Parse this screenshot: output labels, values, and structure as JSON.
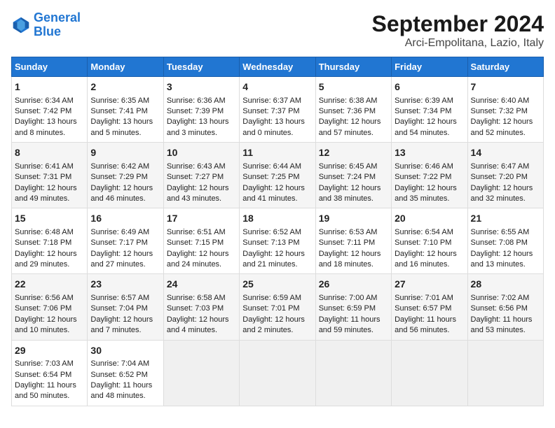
{
  "header": {
    "logo_line1": "General",
    "logo_line2": "Blue",
    "title": "September 2024",
    "subtitle": "Arci-Empolitana, Lazio, Italy"
  },
  "weekdays": [
    "Sunday",
    "Monday",
    "Tuesday",
    "Wednesday",
    "Thursday",
    "Friday",
    "Saturday"
  ],
  "weeks": [
    [
      {
        "day": "1",
        "sunrise": "6:34 AM",
        "sunset": "7:42 PM",
        "daylight": "13 hours and 8 minutes."
      },
      {
        "day": "2",
        "sunrise": "6:35 AM",
        "sunset": "7:41 PM",
        "daylight": "13 hours and 5 minutes."
      },
      {
        "day": "3",
        "sunrise": "6:36 AM",
        "sunset": "7:39 PM",
        "daylight": "13 hours and 3 minutes."
      },
      {
        "day": "4",
        "sunrise": "6:37 AM",
        "sunset": "7:37 PM",
        "daylight": "13 hours and 0 minutes."
      },
      {
        "day": "5",
        "sunrise": "6:38 AM",
        "sunset": "7:36 PM",
        "daylight": "12 hours and 57 minutes."
      },
      {
        "day": "6",
        "sunrise": "6:39 AM",
        "sunset": "7:34 PM",
        "daylight": "12 hours and 54 minutes."
      },
      {
        "day": "7",
        "sunrise": "6:40 AM",
        "sunset": "7:32 PM",
        "daylight": "12 hours and 52 minutes."
      }
    ],
    [
      {
        "day": "8",
        "sunrise": "6:41 AM",
        "sunset": "7:31 PM",
        "daylight": "12 hours and 49 minutes."
      },
      {
        "day": "9",
        "sunrise": "6:42 AM",
        "sunset": "7:29 PM",
        "daylight": "12 hours and 46 minutes."
      },
      {
        "day": "10",
        "sunrise": "6:43 AM",
        "sunset": "7:27 PM",
        "daylight": "12 hours and 43 minutes."
      },
      {
        "day": "11",
        "sunrise": "6:44 AM",
        "sunset": "7:25 PM",
        "daylight": "12 hours and 41 minutes."
      },
      {
        "day": "12",
        "sunrise": "6:45 AM",
        "sunset": "7:24 PM",
        "daylight": "12 hours and 38 minutes."
      },
      {
        "day": "13",
        "sunrise": "6:46 AM",
        "sunset": "7:22 PM",
        "daylight": "12 hours and 35 minutes."
      },
      {
        "day": "14",
        "sunrise": "6:47 AM",
        "sunset": "7:20 PM",
        "daylight": "12 hours and 32 minutes."
      }
    ],
    [
      {
        "day": "15",
        "sunrise": "6:48 AM",
        "sunset": "7:18 PM",
        "daylight": "12 hours and 29 minutes."
      },
      {
        "day": "16",
        "sunrise": "6:49 AM",
        "sunset": "7:17 PM",
        "daylight": "12 hours and 27 minutes."
      },
      {
        "day": "17",
        "sunrise": "6:51 AM",
        "sunset": "7:15 PM",
        "daylight": "12 hours and 24 minutes."
      },
      {
        "day": "18",
        "sunrise": "6:52 AM",
        "sunset": "7:13 PM",
        "daylight": "12 hours and 21 minutes."
      },
      {
        "day": "19",
        "sunrise": "6:53 AM",
        "sunset": "7:11 PM",
        "daylight": "12 hours and 18 minutes."
      },
      {
        "day": "20",
        "sunrise": "6:54 AM",
        "sunset": "7:10 PM",
        "daylight": "12 hours and 16 minutes."
      },
      {
        "day": "21",
        "sunrise": "6:55 AM",
        "sunset": "7:08 PM",
        "daylight": "12 hours and 13 minutes."
      }
    ],
    [
      {
        "day": "22",
        "sunrise": "6:56 AM",
        "sunset": "7:06 PM",
        "daylight": "12 hours and 10 minutes."
      },
      {
        "day": "23",
        "sunrise": "6:57 AM",
        "sunset": "7:04 PM",
        "daylight": "12 hours and 7 minutes."
      },
      {
        "day": "24",
        "sunrise": "6:58 AM",
        "sunset": "7:03 PM",
        "daylight": "12 hours and 4 minutes."
      },
      {
        "day": "25",
        "sunrise": "6:59 AM",
        "sunset": "7:01 PM",
        "daylight": "12 hours and 2 minutes."
      },
      {
        "day": "26",
        "sunrise": "7:00 AM",
        "sunset": "6:59 PM",
        "daylight": "11 hours and 59 minutes."
      },
      {
        "day": "27",
        "sunrise": "7:01 AM",
        "sunset": "6:57 PM",
        "daylight": "11 hours and 56 minutes."
      },
      {
        "day": "28",
        "sunrise": "7:02 AM",
        "sunset": "6:56 PM",
        "daylight": "11 hours and 53 minutes."
      }
    ],
    [
      {
        "day": "29",
        "sunrise": "7:03 AM",
        "sunset": "6:54 PM",
        "daylight": "11 hours and 50 minutes."
      },
      {
        "day": "30",
        "sunrise": "7:04 AM",
        "sunset": "6:52 PM",
        "daylight": "11 hours and 48 minutes."
      },
      null,
      null,
      null,
      null,
      null
    ]
  ]
}
